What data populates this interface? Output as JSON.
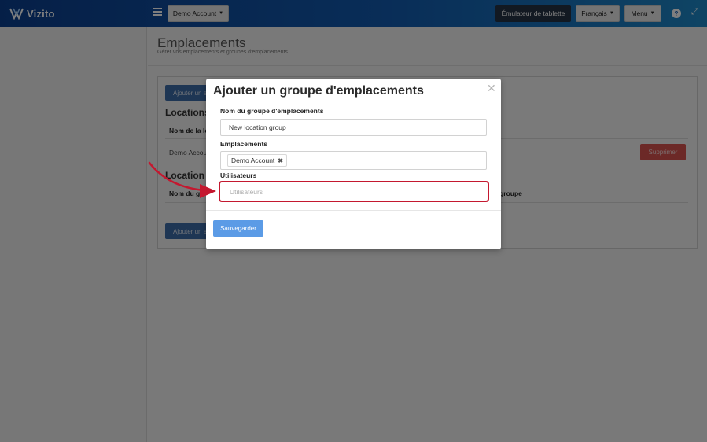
{
  "header": {
    "brand": "Vizito",
    "account_button": "Demo Account",
    "emulator_button": "Émulateur de tablette",
    "language_button": "Français",
    "menu_button": "Menu",
    "help_icon_glyph": "?",
    "expand_icon_glyph": "⤢"
  },
  "page": {
    "title": "Emplacements",
    "subtitle": "Gérer vos emplacements et groupes d'emplacements"
  },
  "background": {
    "add_location_button": "Ajouter un e",
    "locations_heading": "Locations",
    "locations_col1": "Nom de la lo",
    "location_row_name": "Demo Accoun",
    "delete_button": "Supprimer",
    "groups_heading": "Location gr",
    "groups_col1": "Nom du gr",
    "groups_col2": "e groupe",
    "add_group_button": "Ajouter un e"
  },
  "modal": {
    "title": "Ajouter un groupe d'emplacements",
    "close_glyph": "✕",
    "group_name_label": "Nom du groupe d'emplacements",
    "group_name_value": "New location group",
    "locations_label": "Emplacements",
    "location_tag": "Demo Account",
    "location_tag_remove": "✖",
    "users_label": "Utilisateurs",
    "users_placeholder": "Utilisateurs",
    "save_button": "Sauvegarder"
  },
  "colors": {
    "highlight": "#c4182f",
    "primary": "#5b9be6",
    "danger": "#d9534f"
  }
}
